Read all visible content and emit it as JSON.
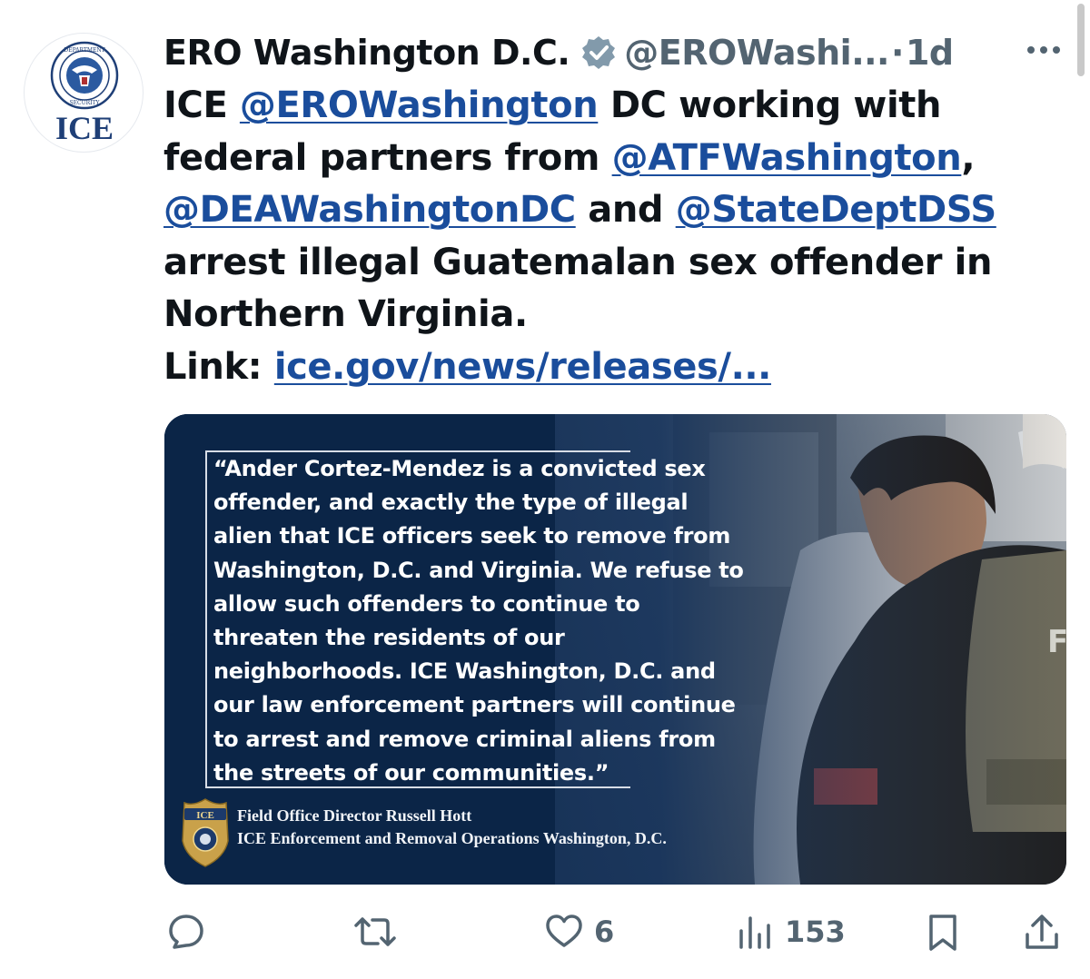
{
  "tweet": {
    "display_name": "ERO Washington D.C.",
    "handle": "@EROWashi...",
    "separator": "·",
    "time": "1d",
    "avatar_text": "ICE",
    "body": {
      "t1": "ICE ",
      "m1": "@EROWashington",
      "t2": " DC working with federal partners from ",
      "m2": "@ATFWashington",
      "t3": ", ",
      "m3": "@DEAWashingtonDC",
      "t4": " and ",
      "m4": "@StateDeptDSS",
      "t5": " arrest illegal Guatemalan sex offender in Northern Virginia.",
      "link_label": "Link: ",
      "link": "ice.gov/news/releases/..."
    }
  },
  "media": {
    "quote_lines": [
      "“Ander Cortez-Mendez is a convicted sex",
      "offender, and exactly the type of illegal",
      "alien that ICE officers seek to remove from",
      "Washington, D.C. and Virginia. We refuse to",
      "allow such offenders to continue to",
      "threaten the residents of our",
      "neighborhoods. ICE Washington, D.C. and",
      "our law enforcement partners will continue",
      "to arrest and remove criminal aliens from",
      "the streets of our communities.”"
    ],
    "attribution_name": "Field Office Director Russell Hott",
    "attribution_org": "ICE Enforcement and Removal Operations Washington, D.C.",
    "badge_text": "ICE",
    "vest_letter": "F"
  },
  "actions": {
    "reply_icon": "reply-icon",
    "retweet_icon": "retweet-icon",
    "like_icon": "heart-icon",
    "like_count": "6",
    "views_icon": "views-icon",
    "views_count": "153",
    "bookmark_icon": "bookmark-icon",
    "share_icon": "share-icon"
  },
  "colors": {
    "link": "#1a4d9c",
    "muted": "#536471",
    "text": "#0f1419",
    "verified": "#829aab",
    "media_bg": "#0b2547"
  }
}
